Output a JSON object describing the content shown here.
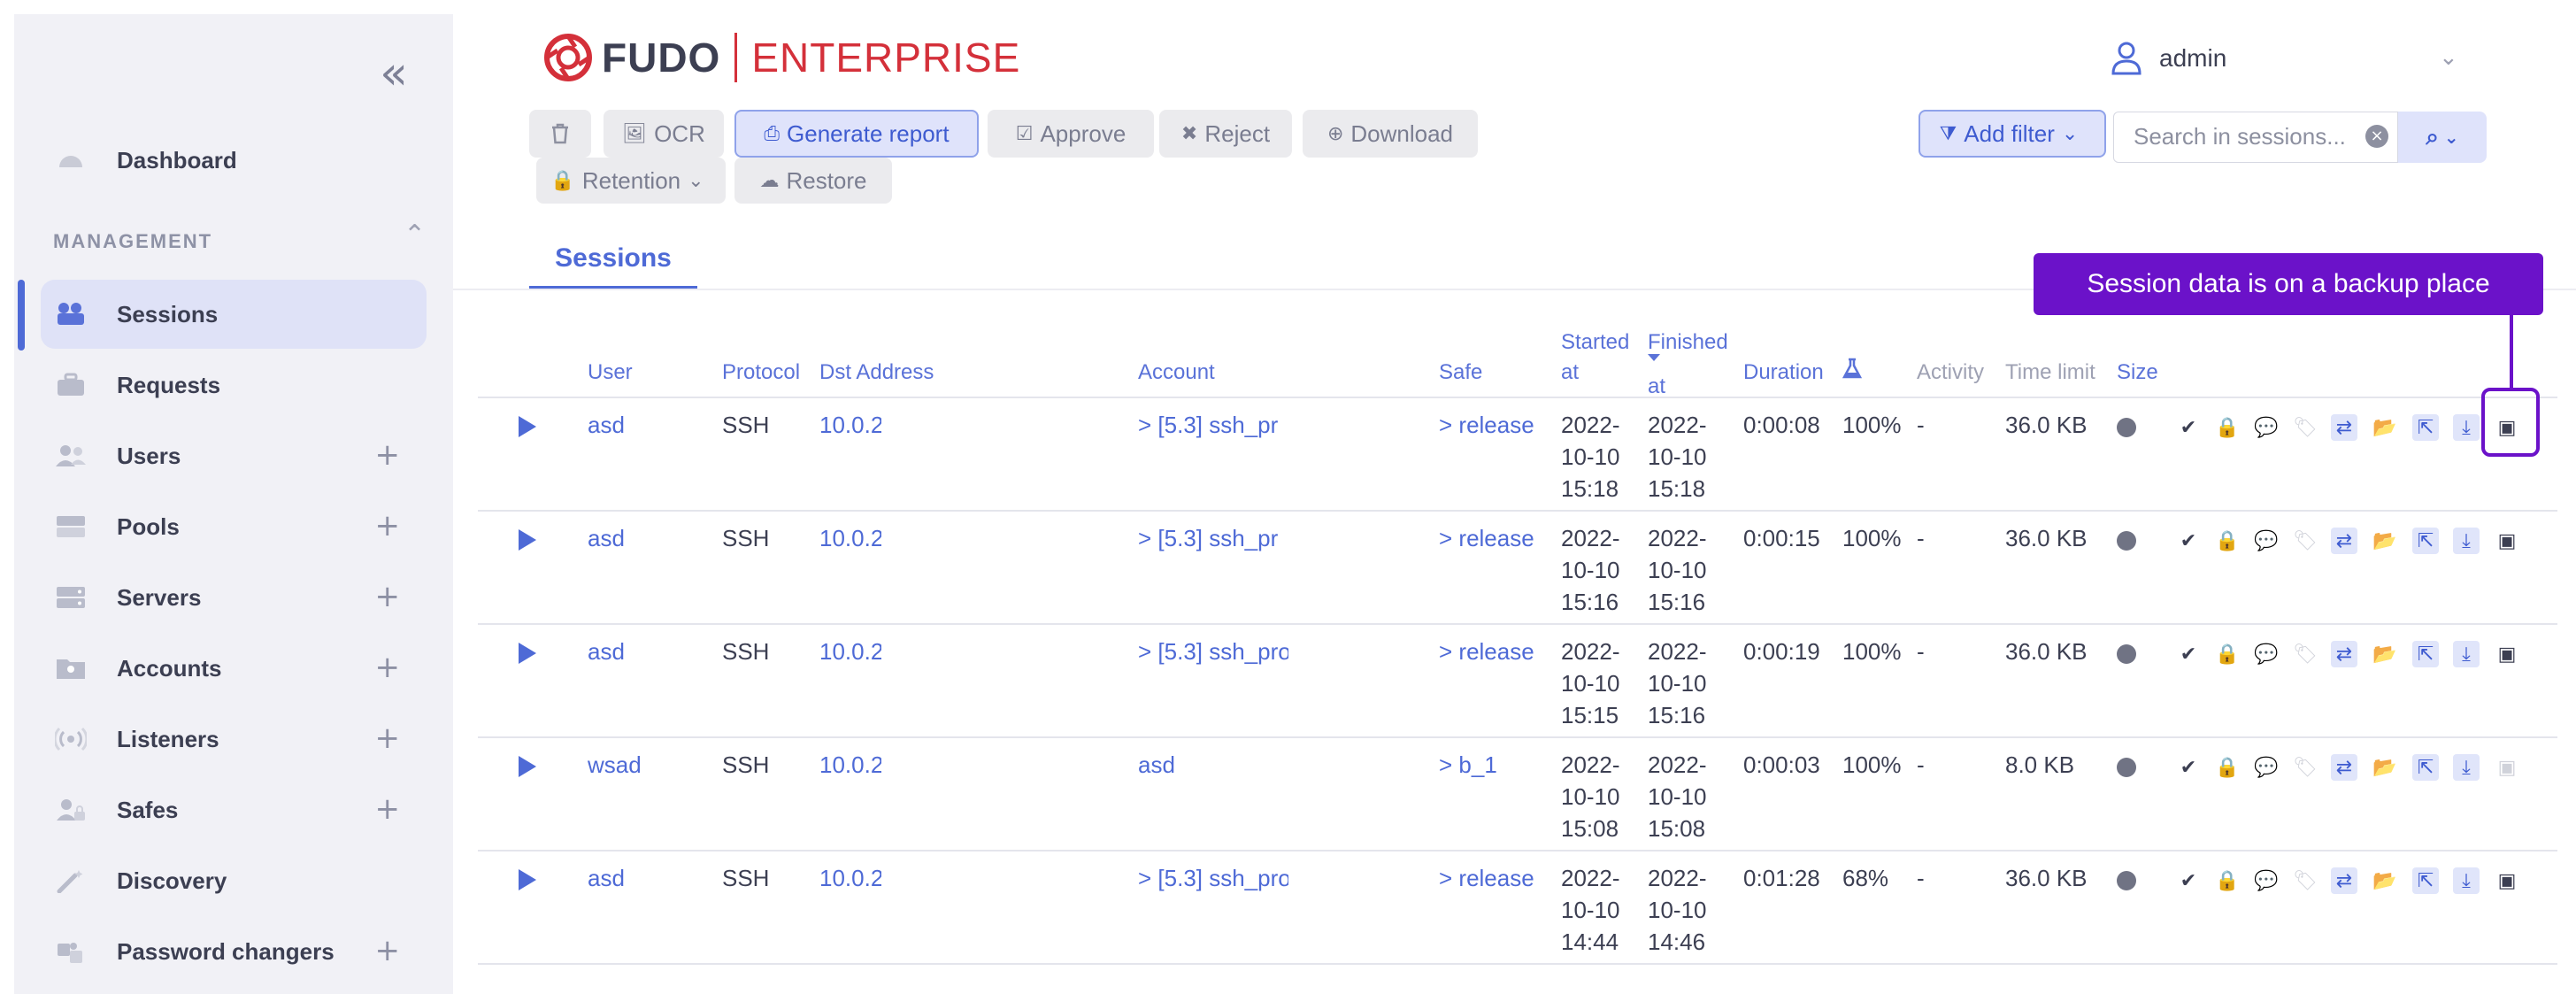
{
  "sidebar": {
    "collapse_icon": "double-chevron-left-icon",
    "dashboard": "Dashboard",
    "section_title": "MANAGEMENT",
    "items": [
      {
        "label": "Sessions",
        "icon": "camera-icon",
        "active": true,
        "expandable": false
      },
      {
        "label": "Requests",
        "icon": "briefcase-icon",
        "active": false,
        "expandable": false
      },
      {
        "label": "Users",
        "icon": "users-icon",
        "active": false,
        "expandable": true
      },
      {
        "label": "Pools",
        "icon": "pools-icon",
        "active": false,
        "expandable": true
      },
      {
        "label": "Servers",
        "icon": "server-icon",
        "active": false,
        "expandable": true
      },
      {
        "label": "Accounts",
        "icon": "accounts-icon",
        "active": false,
        "expandable": true
      },
      {
        "label": "Listeners",
        "icon": "listener-icon",
        "active": false,
        "expandable": true
      },
      {
        "label": "Safes",
        "icon": "safe-user-icon",
        "active": false,
        "expandable": true
      },
      {
        "label": "Discovery",
        "icon": "wand-icon",
        "active": false,
        "expandable": false
      },
      {
        "label": "Password changers",
        "icon": "puzzle-icon",
        "active": false,
        "expandable": true
      }
    ],
    "plus": "+"
  },
  "header": {
    "logo_left": "FUDO",
    "logo_right": "ENTERPRISE",
    "user": "admin",
    "user_chevron": "⌄"
  },
  "toolbar": {
    "delete_icon": "trash-icon",
    "ocr": "OCR",
    "generate_report": "Generate report",
    "approve": "Approve",
    "reject": "Reject",
    "download": "Download",
    "retention": "Retention",
    "restore": "Restore",
    "add_filter": "Add filter",
    "search_placeholder": "Search in sessions...",
    "search_value": ""
  },
  "tabs": {
    "sessions": "Sessions"
  },
  "table": {
    "columns": {
      "user": "User",
      "protocol": "Protocol",
      "dst_address": "Dst Address",
      "account": "Account",
      "safe": "Safe",
      "started_1": "Started",
      "started_2": "at",
      "finished_1": "Finished",
      "finished_2": "at",
      "duration": "Duration",
      "score_icon": "flask-icon",
      "activity": "Activity",
      "time_limit": "Time limit",
      "size": "Size"
    },
    "rows": [
      {
        "user": "asd",
        "protocol": "SSH",
        "dst": "10.0.2",
        "account": "> [5.3] ssh_pr",
        "safe": "> release",
        "start_date": "2022-",
        "start_md": "10-10",
        "start_time": "15:18",
        "end_date": "2022-",
        "end_md": "10-10",
        "end_time": "15:18",
        "duration": "0:00:08",
        "score": "100%",
        "activity": "-",
        "size": "36.0 KB",
        "archived": true
      },
      {
        "user": "asd",
        "protocol": "SSH",
        "dst": "10.0.2",
        "account": "> [5.3] ssh_pr",
        "safe": "> release",
        "start_date": "2022-",
        "start_md": "10-10",
        "start_time": "15:16",
        "end_date": "2022-",
        "end_md": "10-10",
        "end_time": "15:16",
        "duration": "0:00:15",
        "score": "100%",
        "activity": "-",
        "size": "36.0 KB",
        "archived": true
      },
      {
        "user": "asd",
        "protocol": "SSH",
        "dst": "10.0.2",
        "account": "> [5.3] ssh_pro",
        "safe": "> release",
        "start_date": "2022-",
        "start_md": "10-10",
        "start_time": "15:15",
        "end_date": "2022-",
        "end_md": "10-10",
        "end_time": "15:16",
        "duration": "0:00:19",
        "score": "100%",
        "activity": "-",
        "size": "36.0 KB",
        "archived": true
      },
      {
        "user": "wsad",
        "protocol": "SSH",
        "dst": "10.0.2",
        "account": "asd",
        "safe": "> b_1",
        "start_date": "2022-",
        "start_md": "10-10",
        "start_time": "15:08",
        "end_date": "2022-",
        "end_md": "10-10",
        "end_time": "15:08",
        "duration": "0:00:03",
        "score": "100%",
        "activity": "-",
        "size": "8.0 KB",
        "archived": false
      },
      {
        "user": "asd",
        "protocol": "SSH",
        "dst": "10.0.2",
        "account": "> [5.3] ssh_pro",
        "safe": "> release",
        "start_date": "2022-",
        "start_md": "10-10",
        "start_time": "14:44",
        "end_date": "2022-",
        "end_md": "10-10",
        "end_time": "14:46",
        "duration": "0:01:28",
        "score": "68%",
        "activity": "-",
        "size": "36.0 KB",
        "archived": true
      }
    ]
  },
  "tooltip": {
    "text": "Session data is on a backup place"
  },
  "colors": {
    "accent": "#4e6ad6",
    "tooltip": "#6b12c9",
    "brand_red": "#d4303a"
  }
}
